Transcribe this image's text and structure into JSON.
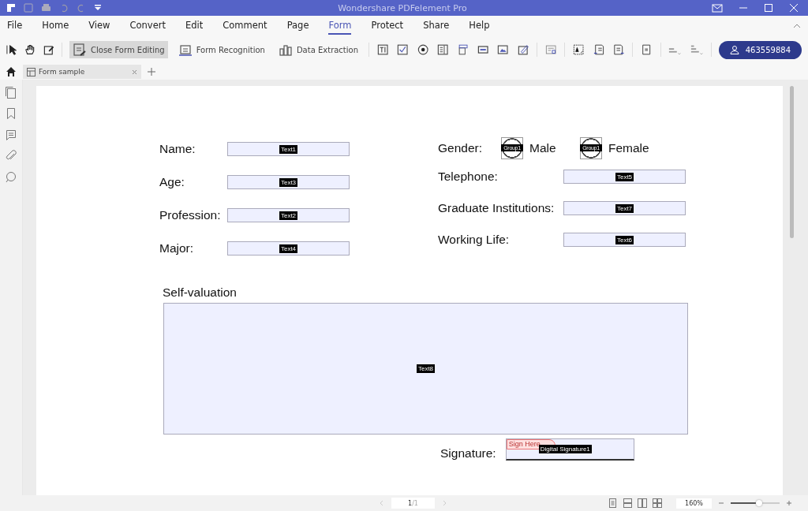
{
  "window": {
    "title": "Wondershare PDFelement Pro"
  },
  "menu": [
    {
      "label": "File",
      "selected": false
    },
    {
      "label": "Home",
      "selected": false
    },
    {
      "label": "View",
      "selected": false
    },
    {
      "label": "Convert",
      "selected": false
    },
    {
      "label": "Edit",
      "selected": false
    },
    {
      "label": "Comment",
      "selected": false
    },
    {
      "label": "Page",
      "selected": false
    },
    {
      "label": "Form",
      "selected": true
    },
    {
      "label": "Protect",
      "selected": false
    },
    {
      "label": "Share",
      "selected": false
    },
    {
      "label": "Help",
      "selected": false
    }
  ],
  "toolbar": {
    "buttons": [
      {
        "label": "Close Form Editing",
        "selected": true
      },
      {
        "label": "Form Recognition",
        "selected": false
      },
      {
        "label": "Data Extraction",
        "selected": false
      }
    ],
    "account": "463559884"
  },
  "tabs": [
    {
      "label": "Form sample",
      "selected": true
    }
  ],
  "form": {
    "left": [
      {
        "label": "Name:",
        "field": "Text1"
      },
      {
        "label": "Age:",
        "field": "Text3"
      },
      {
        "label": "Profession:",
        "field": "Text2"
      },
      {
        "label": "Major:",
        "field": "Text4"
      }
    ],
    "gender": {
      "label": "Gender:",
      "options": [
        {
          "tag": "Group1",
          "label": "Male"
        },
        {
          "tag": "Group1",
          "label": "Female"
        }
      ]
    },
    "right": [
      {
        "label": "Telephone:",
        "field": "Text5"
      },
      {
        "label": "Graduate Institutions:",
        "field": "Text7"
      },
      {
        "label": "Working Life:",
        "field": "Text6"
      }
    ],
    "self_valuation": {
      "label": "Self-valuation",
      "field": "Text8"
    },
    "signature": {
      "label": "Signature:",
      "sign_here": "Sign Here",
      "field": "Digital Signature1"
    }
  },
  "status_bar": {
    "page": "1",
    "page_total": "/1",
    "zoom": "160%",
    "zoom_slider": {
      "level": 0.58
    }
  }
}
